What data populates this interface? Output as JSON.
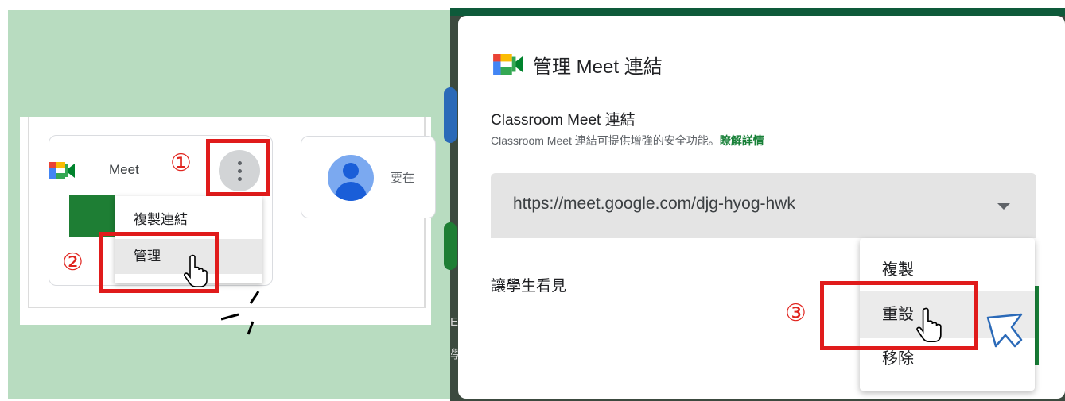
{
  "left_panel": {
    "meet_card": {
      "label": "Meet"
    },
    "step1": "①",
    "step2": "②",
    "menu": {
      "items": [
        "複製連結",
        "管理"
      ],
      "highlighted_index": 1
    },
    "profile_card": {
      "text": "要在"
    }
  },
  "dialog": {
    "title": "管理 Meet 連結",
    "section_title": "Classroom Meet 連結",
    "description": "Classroom Meet 連結可提供增強的安全功能。",
    "learn_more": "瞭解詳情",
    "link_value": "https://meet.google.com/djg-hyog-hwk",
    "visible_to_students": "讓學生看見",
    "step3": "③",
    "menu": {
      "items": [
        "複製",
        "重設",
        "移除"
      ],
      "highlighted_index": 1
    }
  },
  "colors": {
    "highlight_box": "#e01b1b",
    "left_background": "#b8dcc0",
    "link_accent": "#188038",
    "meet_green": "#1e7e34"
  },
  "icons": [
    "google-meet-logo-icon",
    "more-vert-icon",
    "hand-cursor-icon",
    "arrow-cursor-icon",
    "dropdown-caret-icon",
    "avatar-icon"
  ]
}
